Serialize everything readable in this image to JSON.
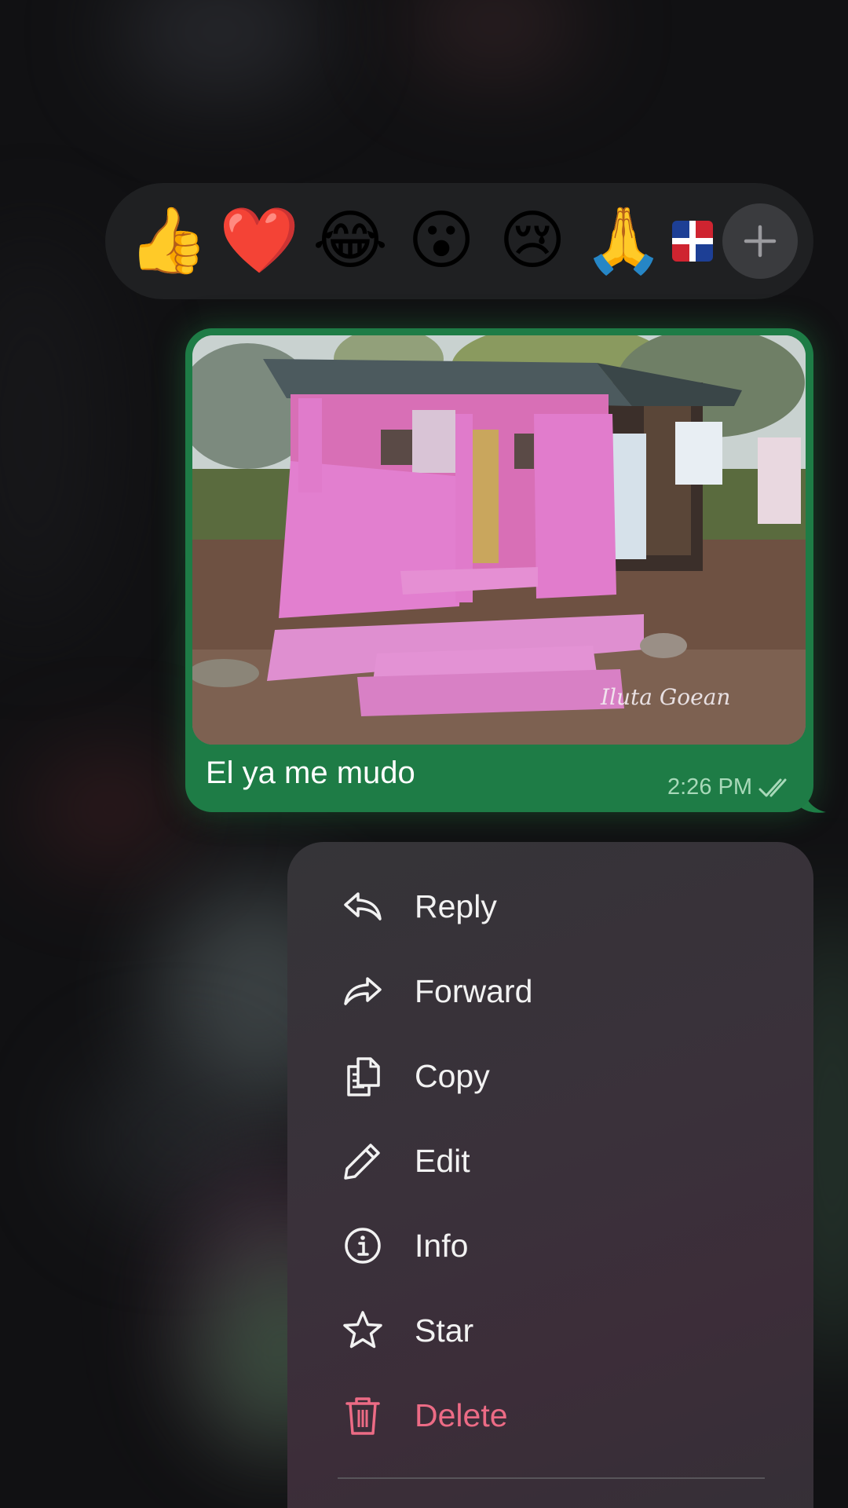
{
  "reactions": {
    "items": [
      {
        "emoji": "👍",
        "name": "thumbs-up"
      },
      {
        "emoji": "❤️",
        "name": "red-heart"
      },
      {
        "emoji": "😂",
        "name": "tears-of-joy"
      },
      {
        "emoji": "😮",
        "name": "open-mouth"
      },
      {
        "emoji": "😢",
        "name": "crying-face"
      },
      {
        "emoji": "🙏",
        "name": "folded-hands"
      }
    ],
    "flag_icon": "dominican-republic-flag-icon",
    "more_icon": "plus-icon"
  },
  "message": {
    "text": "El ya me mudo",
    "time": "2:26 PM",
    "status_icon": "double-check-icon",
    "photo_watermark": "Iluta Goean",
    "bubble_color": "#1e7c46"
  },
  "menu": {
    "items": [
      {
        "label": "Reply",
        "icon": "reply-icon"
      },
      {
        "label": "Forward",
        "icon": "forward-icon"
      },
      {
        "label": "Copy",
        "icon": "copy-icon"
      },
      {
        "label": "Edit",
        "icon": "pencil-icon"
      },
      {
        "label": "Info",
        "icon": "info-icon"
      },
      {
        "label": "Star",
        "icon": "star-icon"
      },
      {
        "label": "Delete",
        "icon": "trash-icon"
      }
    ],
    "danger_color": "#ec6b85"
  }
}
